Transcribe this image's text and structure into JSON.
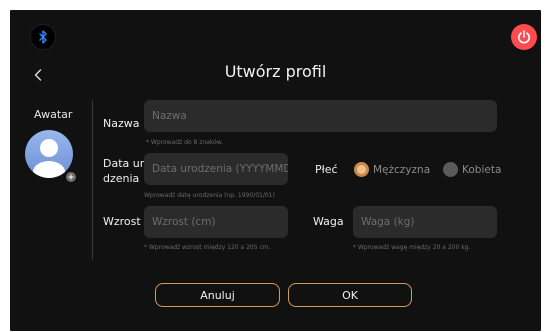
{
  "header": {
    "title": "Utwórz profil"
  },
  "avatar": {
    "label": "Awatar"
  },
  "form": {
    "name": {
      "label": "Nazwa",
      "placeholder": "Nazwa",
      "hint": "* Wprowadź do 8 znaków."
    },
    "birthdate": {
      "label_line1": "Data uro",
      "label_line2": "dzenia",
      "placeholder": "Data urodzenia (YYYYMMDD",
      "hint": "Wprowadź datę urodzenia (np. 1990/01/01)"
    },
    "gender": {
      "label": "Płeć",
      "options": [
        {
          "label": "Mężczyzna",
          "selected": true
        },
        {
          "label": "Kobieta",
          "selected": false
        }
      ]
    },
    "height": {
      "label": "Wzrost",
      "placeholder": "Wzrost (cm)",
      "hint": "* Wprowadź wzrost między 120 a 205 cm."
    },
    "weight": {
      "label": "Waga",
      "placeholder": "Waga (kg)",
      "hint": "* Wprowadź wagę między 20 a 200 kg."
    }
  },
  "actions": {
    "cancel_label": "Anuluj",
    "ok_label": "OK"
  },
  "icons": {
    "bluetooth": "bluetooth-icon",
    "power": "power-icon",
    "back": "chevron-left-icon"
  },
  "colors": {
    "accent": "#d49a56",
    "power": "#ff4a4f",
    "background": "#111111",
    "field": "#2b2b2b"
  }
}
